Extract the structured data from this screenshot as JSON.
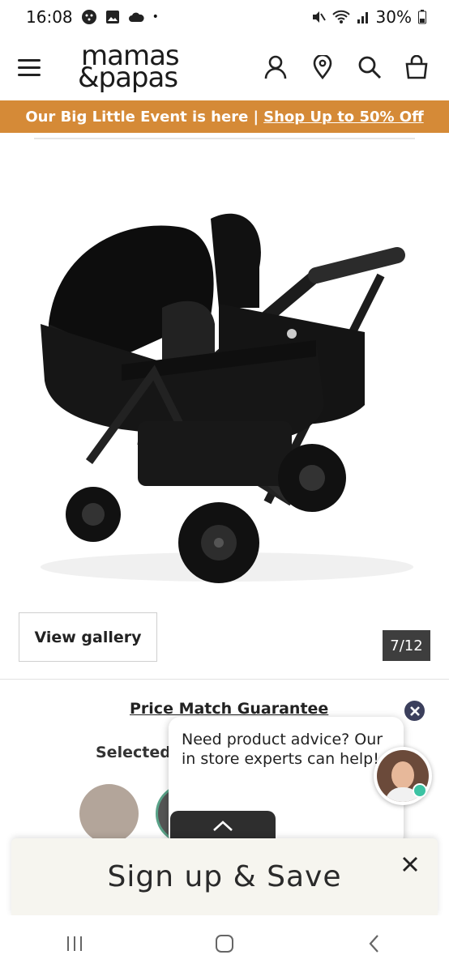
{
  "status_bar": {
    "time": "16:08",
    "battery": "30%",
    "dot": "•"
  },
  "header": {
    "logo_line1": "mamas",
    "logo_line2": "&papas"
  },
  "promo": {
    "text": "Our Big Little Event is here |",
    "link": "Shop Up to 50% Off",
    "color": "#d58a37"
  },
  "gallery": {
    "button_label": "View gallery",
    "counter": "7/12"
  },
  "product": {
    "price_match": "Price Match Guarantee",
    "selected_label": "Selected"
  },
  "chat": {
    "message": "Need product advice? Our in store experts can help!"
  },
  "signup": {
    "text": "Sign up & Save"
  }
}
